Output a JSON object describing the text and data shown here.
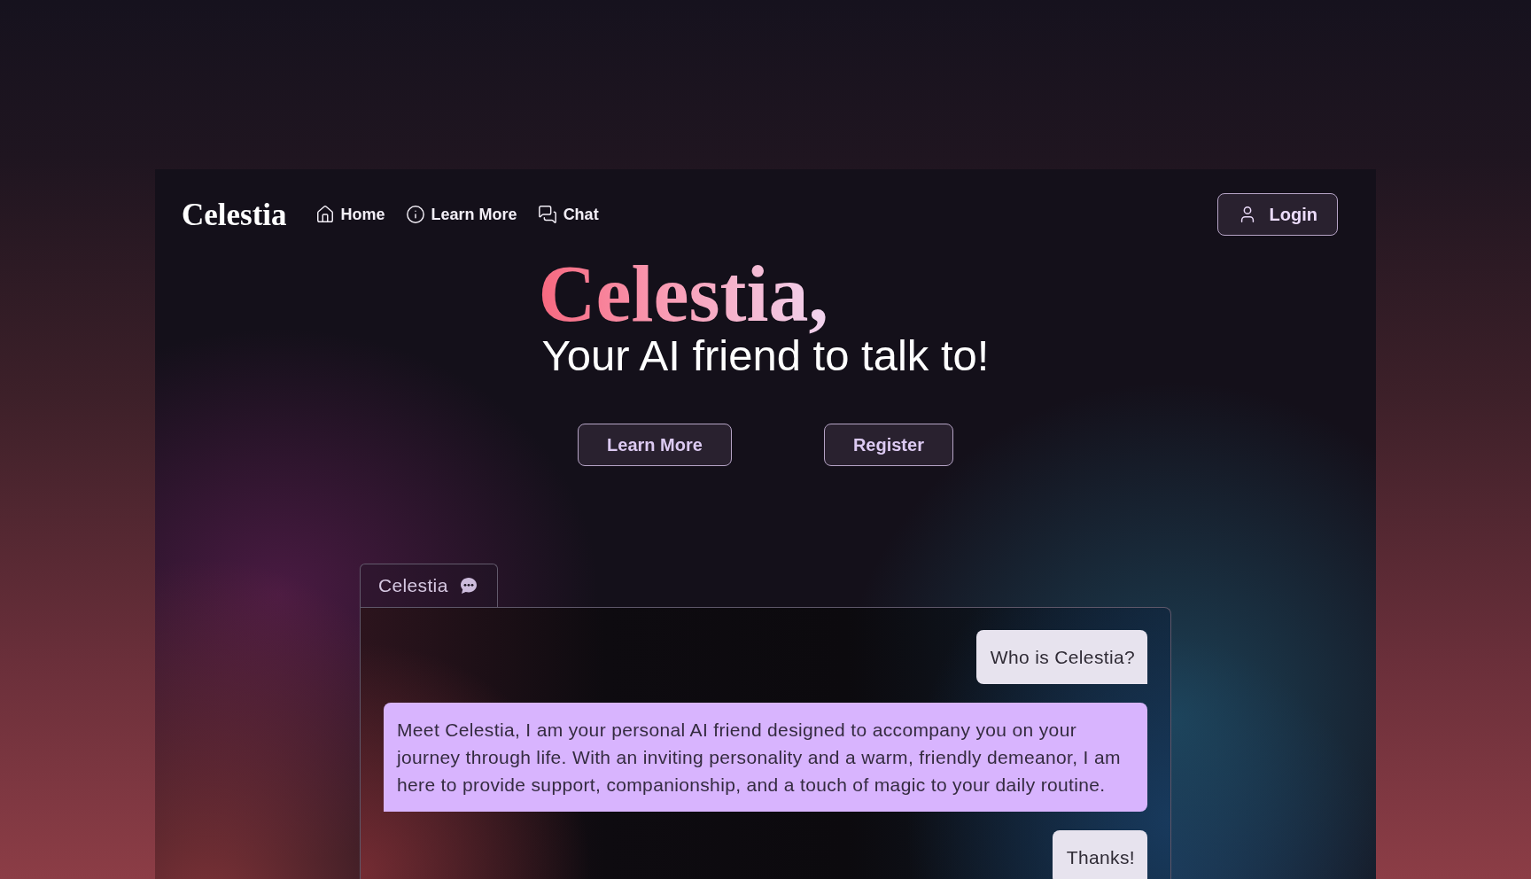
{
  "nav": {
    "logo": "Celestia",
    "links": [
      {
        "label": "Home"
      },
      {
        "label": "Learn More"
      },
      {
        "label": "Chat"
      }
    ],
    "login": "Login"
  },
  "hero": {
    "title": "Celestia,",
    "subtitle": "Your AI friend to talk to!",
    "buttons": [
      "Learn More",
      "Register"
    ]
  },
  "chat": {
    "tab": "Celestia",
    "messages": [
      {
        "kind": "outgoing",
        "text": "Who is Celestia?"
      },
      {
        "kind": "incoming",
        "text": "Meet Celestia, I am your personal AI friend designed to accompany you on your journey through life. With an inviting personality and a warm, friendly demeanor, I am here to provide support, companionship, and a touch of magic to your daily routine."
      },
      {
        "kind": "outgoing",
        "text": "Thanks!"
      }
    ]
  }
}
